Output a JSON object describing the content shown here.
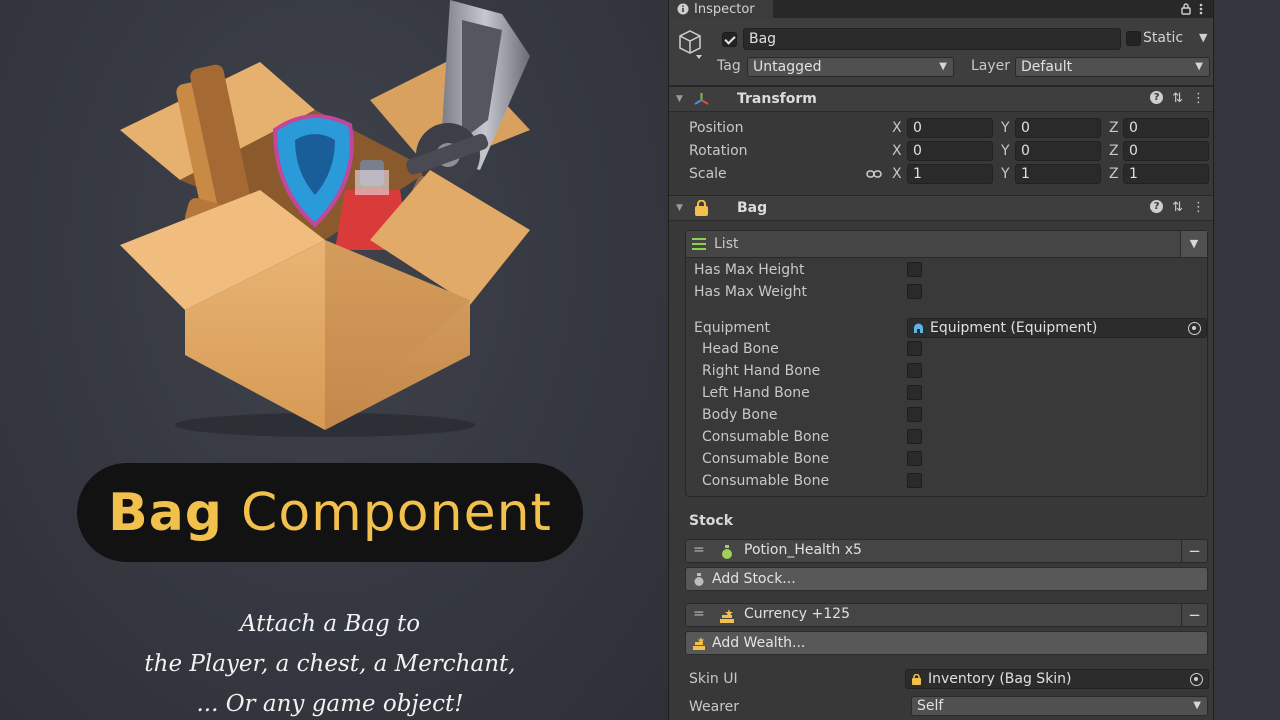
{
  "promo": {
    "title_bold": "Bag",
    "title_rest": "Component",
    "tagline_lines": [
      "Attach a Bag to",
      "the Player, a chest, a Merchant,",
      "... Or any game object!"
    ]
  },
  "inspector": {
    "tab_label": "Inspector",
    "object_name": "Bag",
    "active": true,
    "static_label": "Static",
    "static_checked": false,
    "tag_label": "Tag",
    "tag_value": "Untagged",
    "layer_label": "Layer",
    "layer_value": "Default",
    "transform": {
      "title": "Transform",
      "rows": [
        {
          "label": "Position",
          "x": "0",
          "y": "0",
          "z": "0"
        },
        {
          "label": "Rotation",
          "x": "0",
          "y": "0",
          "z": "0"
        },
        {
          "label": "Scale",
          "x": "1",
          "y": "1",
          "z": "1"
        }
      ],
      "axis_labels": [
        "X",
        "Y",
        "Z"
      ]
    },
    "bag": {
      "title": "Bag",
      "list_label": "List",
      "has_max_height": "Has Max Height",
      "has_max_weight": "Has Max Weight",
      "equipment_label": "Equipment",
      "equipment_value": "Equipment (Equipment)",
      "bones": [
        "Head Bone",
        "Right Hand Bone",
        "Left Hand Bone",
        "Body Bone",
        "Consumable Bone",
        "Consumable Bone",
        "Consumable Bone"
      ],
      "stock_label": "Stock",
      "stock_item": "Potion_Health x5",
      "add_stock": "Add Stock...",
      "wealth_item": "Currency +125",
      "add_wealth": "Add Wealth...",
      "skin_label": "Skin UI",
      "skin_value": "Inventory (Bag Skin)",
      "wearer_label": "Wearer",
      "wearer_value": "Self"
    }
  },
  "colors": {
    "accent_yellow": "#f2c04d",
    "inspector_bg": "#383838",
    "field_bg": "#2a2a2a"
  },
  "icons": [
    "info-icon",
    "lock-icon",
    "more-icon",
    "cube-icon",
    "transform-axes-icon",
    "bag-lock-icon",
    "help-icon",
    "settings-icon",
    "list-icon",
    "helmet-icon",
    "target-icon",
    "potion-icon",
    "currency-icon",
    "link-icon"
  ]
}
